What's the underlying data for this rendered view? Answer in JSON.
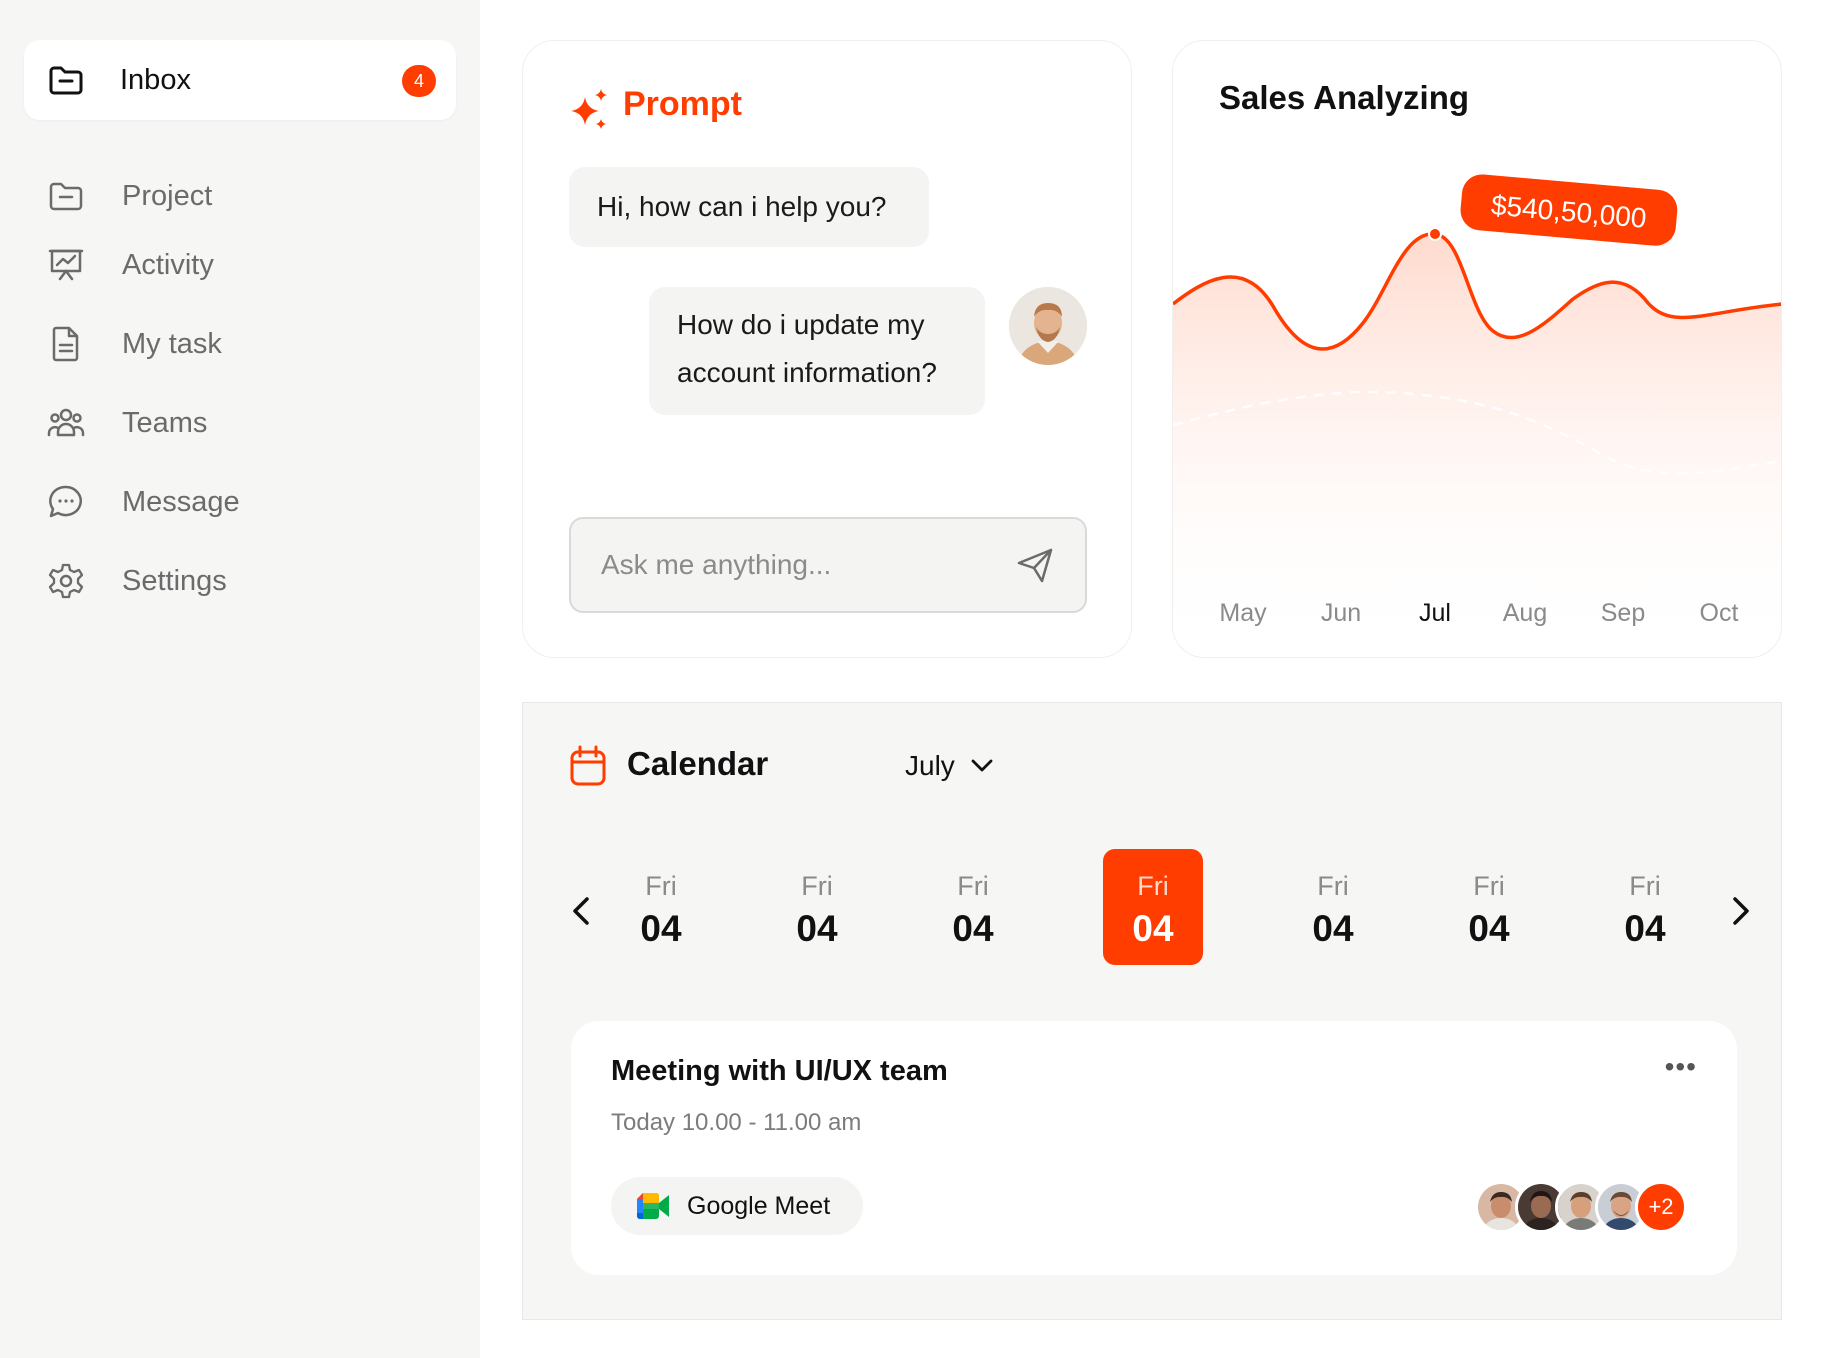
{
  "sidebar": {
    "items": [
      {
        "label": "Inbox",
        "icon": "folder-icon",
        "badge": "4",
        "active": true
      },
      {
        "label": "Project",
        "icon": "folder-icon"
      },
      {
        "label": "Activity",
        "icon": "presentation-chart-icon"
      },
      {
        "label": "My task",
        "icon": "document-icon"
      },
      {
        "label": "Teams",
        "icon": "users-icon"
      },
      {
        "label": "Message",
        "icon": "chat-bubble-icon"
      },
      {
        "label": "Settings",
        "icon": "gear-icon"
      }
    ]
  },
  "prompt": {
    "title": "Prompt",
    "bot_message": "Hi, how can i help you?",
    "user_message_line1": "How do i update my",
    "user_message_line2": "account information?",
    "input_placeholder": "Ask me anything..."
  },
  "sales": {
    "title": "Sales Analyzing",
    "tooltip": "$540,50,000"
  },
  "chart_data": {
    "type": "area",
    "title": "Sales Analyzing",
    "categories": [
      "May",
      "Jun",
      "Jul",
      "Aug",
      "Sep",
      "Oct"
    ],
    "highlighted_category": "Jul",
    "highlight_label": "$540,50,000",
    "grid": false,
    "accent_color": "#ff3d00"
  },
  "calendar": {
    "title": "Calendar",
    "month": "July",
    "days": [
      {
        "name": "Fri",
        "num": "04",
        "active": false
      },
      {
        "name": "Fri",
        "num": "04",
        "active": false
      },
      {
        "name": "Fri",
        "num": "04",
        "active": false
      },
      {
        "name": "Fri",
        "num": "04",
        "active": true
      },
      {
        "name": "Fri",
        "num": "04",
        "active": false
      },
      {
        "name": "Fri",
        "num": "04",
        "active": false
      },
      {
        "name": "Fri",
        "num": "04",
        "active": false
      }
    ],
    "meeting": {
      "title": "Meeting with UI/UX team",
      "time": "Today 10.00 - 11.00 am",
      "platform": "Google Meet",
      "more_attendees": "+2"
    }
  },
  "colors": {
    "accent": "#ff3d00",
    "sidebar_bg": "#f6f6f5",
    "muted_text": "#6b6b6b"
  }
}
